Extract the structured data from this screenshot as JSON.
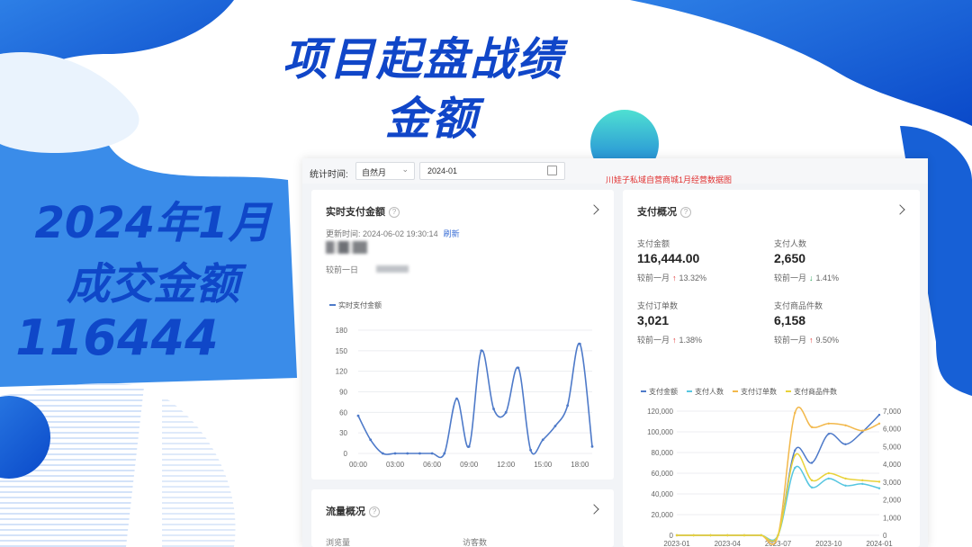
{
  "headline": {
    "line1": "项目起盘战绩",
    "line2": "金额"
  },
  "side_text": {
    "line1": "2024年1月",
    "line2": "成交金额",
    "line3": "116444"
  },
  "toolbar": {
    "stat_label": "统计时间:",
    "period_value": "自然月",
    "date_value": "2024-01",
    "note": "川娃子私域自营商城1月经营数据图"
  },
  "realtime_card": {
    "title": "实时支付金额",
    "updated_text": "更新时间: 2024-06-02 19:30:14",
    "refresh_label": "刷新",
    "compare_label": "较前一日",
    "legend": "实时支付金额"
  },
  "payment_card": {
    "title": "支付概况",
    "metrics": [
      {
        "label": "支付金额",
        "value": "116,444.00",
        "compare": "较前一月",
        "dir": "up",
        "change": "13.32%"
      },
      {
        "label": "支付人数",
        "value": "2,650",
        "compare": "较前一月",
        "dir": "down",
        "change": "1.41%"
      },
      {
        "label": "支付订单数",
        "value": "3,021",
        "compare": "较前一月",
        "dir": "up",
        "change": "1.38%"
      },
      {
        "label": "支付商品件数",
        "value": "6,158",
        "compare": "较前一月",
        "dir": "up",
        "change": "9.50%"
      }
    ]
  },
  "traffic_card": {
    "title": "流量概况",
    "col1": "浏览量",
    "col2": "访客数"
  },
  "colors": {
    "accent": "#1046c8",
    "line_blue": "#4e7ac9",
    "up": "#e03030",
    "down": "#2aa65a"
  },
  "chart_data": [
    {
      "type": "line",
      "x": [
        "00:00",
        "01:00",
        "02:00",
        "03:00",
        "04:00",
        "05:00",
        "06:00",
        "07:00",
        "08:00",
        "09:00",
        "10:00",
        "11:00",
        "12:00",
        "13:00",
        "14:00",
        "15:00",
        "16:00",
        "17:00",
        "18:00",
        "19:00"
      ],
      "series": [
        {
          "name": "实时支付金额",
          "values": [
            55,
            20,
            0,
            0,
            0,
            0,
            0,
            0,
            80,
            10,
            150,
            65,
            60,
            125,
            5,
            20,
            40,
            70,
            160,
            10
          ]
        }
      ],
      "xticks": [
        "00:00",
        "03:00",
        "06:00",
        "09:00",
        "12:00",
        "15:00",
        "18:00"
      ],
      "yticks": [
        0,
        30,
        60,
        90,
        120,
        150,
        180
      ],
      "ylim": [
        0,
        180
      ],
      "grid": true,
      "legend": "top-left"
    },
    {
      "type": "line",
      "x": [
        "2023-01",
        "2023-02",
        "2023-03",
        "2023-04",
        "2023-05",
        "2023-06",
        "2023-07",
        "2023-08",
        "2023-09",
        "2023-10",
        "2023-11",
        "2023-12",
        "2024-01"
      ],
      "series": [
        {
          "name": "支付金额",
          "axis": "left",
          "values": [
            0,
            0,
            0,
            0,
            0,
            0,
            0,
            82000,
            70000,
            98000,
            88000,
            100000,
            116444
          ]
        },
        {
          "name": "支付人数",
          "axis": "right",
          "values": [
            0,
            0,
            0,
            0,
            0,
            0,
            0,
            3800,
            2700,
            3200,
            2800,
            2900,
            2650
          ]
        },
        {
          "name": "支付订单数",
          "axis": "right",
          "values": [
            0,
            0,
            0,
            0,
            0,
            0,
            0,
            6900,
            6100,
            6300,
            6200,
            5900,
            6300
          ]
        },
        {
          "name": "支付商品件数",
          "axis": "right",
          "values": [
            0,
            0,
            0,
            0,
            0,
            0,
            0,
            4500,
            3100,
            3500,
            3200,
            3100,
            3021
          ]
        }
      ],
      "xticks": [
        "2023-01",
        "2023-04",
        "2023-07",
        "2023-10",
        "2024-01"
      ],
      "yticks_left": [
        0,
        20000,
        40000,
        60000,
        80000,
        100000,
        120000
      ],
      "yticks_right": [
        0,
        1000,
        2000,
        3000,
        4000,
        5000,
        6000,
        7000
      ],
      "ylim_left": [
        0,
        120000
      ],
      "ylim_right": [
        0,
        7000
      ],
      "grid": true,
      "legend": "top-left",
      "series_colors": [
        "#4e7ac9",
        "#57c6e0",
        "#f2b84b",
        "#e9d23a"
      ]
    }
  ]
}
